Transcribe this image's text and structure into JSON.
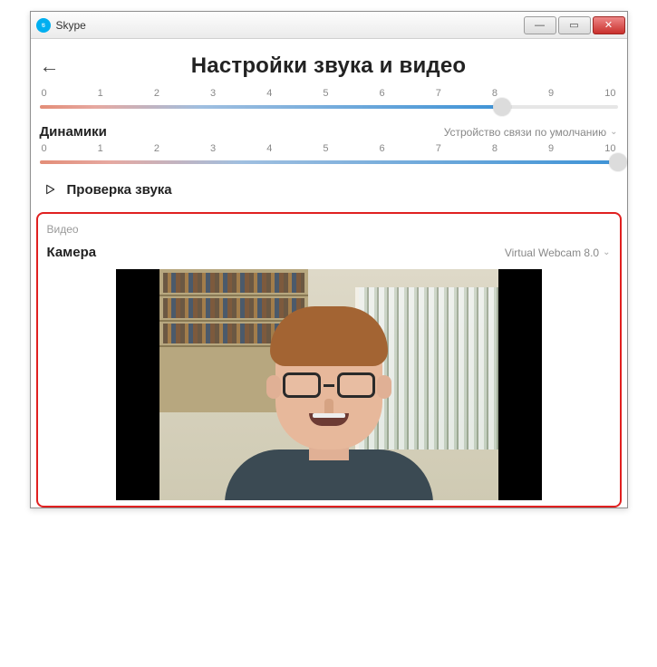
{
  "window": {
    "title": "Skype"
  },
  "header": {
    "title": "Настройки звука и видео"
  },
  "slider1": {
    "ticks": [
      "0",
      "1",
      "2",
      "3",
      "4",
      "5",
      "6",
      "7",
      "8",
      "9",
      "10"
    ],
    "value_percent": 80
  },
  "speakers": {
    "label": "Динамики",
    "device": "Устройство связи по умолчанию"
  },
  "slider2": {
    "ticks": [
      "0",
      "1",
      "2",
      "3",
      "4",
      "5",
      "6",
      "7",
      "8",
      "9",
      "10"
    ],
    "value_percent": 100
  },
  "sound_test": {
    "label": "Проверка звука"
  },
  "video": {
    "section_caption": "Видео",
    "camera_label": "Камера",
    "camera_device": "Virtual Webcam 8.0"
  }
}
